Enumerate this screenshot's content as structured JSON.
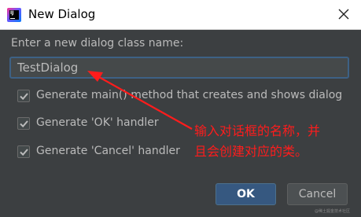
{
  "window": {
    "title": "New Dialog",
    "app_icon": "intellij-idea-icon",
    "close_icon": "close-icon"
  },
  "form": {
    "prompt": "Enter a new dialog class name:",
    "class_name_value": "TestDialog"
  },
  "checkboxes": [
    {
      "label": "Generate main() method that creates and shows dialog",
      "checked": true
    },
    {
      "label": "Generate 'OK' handler",
      "checked": true
    },
    {
      "label": "Generate 'Cancel' handler",
      "checked": true
    }
  ],
  "annotation": {
    "line1": "输入对话框的名称，并",
    "line2": "且会创建对应的类。",
    "color": "#ff1c1c"
  },
  "buttons": {
    "ok": "OK",
    "cancel": "Cancel"
  },
  "watermark": "@稀土掘金技术社区",
  "colors": {
    "background": "#3c3f41",
    "accent": "#365880",
    "text": "#bbbbbb"
  }
}
